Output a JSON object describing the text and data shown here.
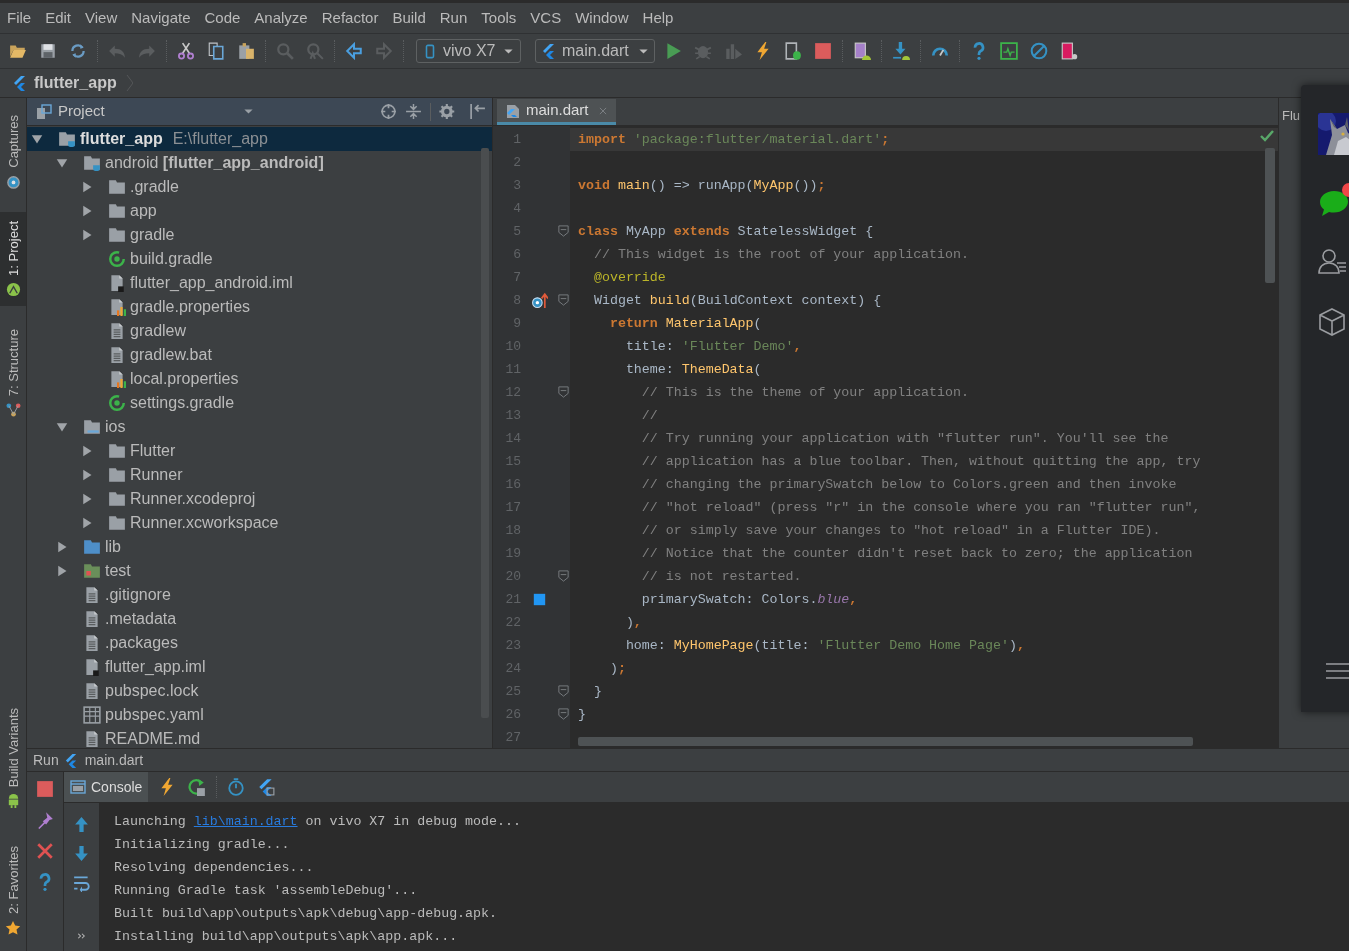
{
  "menu": [
    "File",
    "Edit",
    "View",
    "Navigate",
    "Code",
    "Analyze",
    "Refactor",
    "Build",
    "Run",
    "Tools",
    "VCS",
    "Window",
    "Help"
  ],
  "toolbar": {
    "device": "vivo X7",
    "run_config": "main.dart"
  },
  "breadcrumb": "flutter_app",
  "tool_window_bar": {
    "top": [
      {
        "label": "Captures",
        "selected": false
      },
      {
        "label": "1: Project",
        "selected": true
      },
      {
        "label": "7: Structure",
        "selected": false
      }
    ],
    "bottom": [
      {
        "label": "Build Variants",
        "selected": false
      },
      {
        "label": "2: Favorites",
        "selected": false
      }
    ]
  },
  "project": {
    "view": "Project",
    "tree": [
      {
        "label": "flutter_app",
        "path": "E:\\flutter_app",
        "kind": "module",
        "expanded": true,
        "selected": true,
        "children": [
          {
            "label": "android **[flutter_app_android]**",
            "kind": "module",
            "expanded": true,
            "selected": false,
            "children": [
              {
                "label": ".gradle",
                "kind": "folder",
                "expanded": false,
                "selected": false
              },
              {
                "label": "app",
                "kind": "folder",
                "expanded": false,
                "selected": false
              },
              {
                "label": "gradle",
                "kind": "folder",
                "expanded": false,
                "selected": false
              },
              {
                "label": "build.gradle",
                "kind": "gradle",
                "selected": false
              },
              {
                "label": "flutter_app_android.iml",
                "kind": "iml",
                "selected": false
              },
              {
                "label": "gradle.properties",
                "kind": "properties",
                "selected": false
              },
              {
                "label": "gradlew",
                "kind": "text",
                "selected": false
              },
              {
                "label": "gradlew.bat",
                "kind": "text",
                "selected": false
              },
              {
                "label": "local.properties",
                "kind": "properties",
                "selected": false
              },
              {
                "label": "settings.gradle",
                "kind": "gradle",
                "selected": false
              }
            ]
          },
          {
            "label": "ios",
            "kind": "module_folder",
            "expanded": true,
            "selected": false,
            "children": [
              {
                "label": "Flutter",
                "kind": "folder",
                "expanded": false,
                "selected": false
              },
              {
                "label": "Runner",
                "kind": "folder",
                "expanded": false,
                "selected": false
              },
              {
                "label": "Runner.xcodeproj",
                "kind": "folder",
                "expanded": false,
                "selected": false
              },
              {
                "label": "Runner.xcworkspace",
                "kind": "folder",
                "expanded": false,
                "selected": false
              }
            ]
          },
          {
            "label": "lib",
            "kind": "source",
            "expanded": false,
            "selected": false
          },
          {
            "label": "test",
            "kind": "test",
            "expanded": false,
            "selected": false
          },
          {
            "label": ".gitignore",
            "kind": "text",
            "selected": false
          },
          {
            "label": ".metadata",
            "kind": "text",
            "selected": false
          },
          {
            "label": ".packages",
            "kind": "text",
            "selected": false
          },
          {
            "label": "flutter_app.iml",
            "kind": "iml",
            "selected": false
          },
          {
            "label": "pubspec.lock",
            "kind": "text",
            "selected": false
          },
          {
            "label": "pubspec.yaml",
            "kind": "table",
            "selected": false
          },
          {
            "label": "README.md",
            "kind": "text",
            "selected": false
          }
        ]
      }
    ]
  },
  "editor": {
    "tabs": [
      {
        "label": "main.dart",
        "selected": true
      }
    ],
    "lines": [
      {
        "n": "1",
        "current": true,
        "fold": false,
        "tokens": [
          {
            "text": "import",
            "kind": "keyword"
          },
          {
            "text": " 'package:flutter/material.dart'",
            "kind": "string"
          },
          {
            "text": ";",
            "kind": "keyword"
          }
        ]
      },
      {
        "n": "2",
        "current": false,
        "fold": false
      },
      {
        "n": "3",
        "current": false,
        "fold": false,
        "tokens": [
          {
            "text": "void",
            "kind": "keyword"
          },
          {
            "text": " main",
            "kind": "call"
          },
          {
            "text": "() => runApp(",
            "kind": "plain"
          },
          {
            "text": "MyApp",
            "kind": "call"
          },
          {
            "text": "())",
            "kind": "plain"
          },
          {
            "text": ";",
            "kind": "keyword"
          }
        ]
      },
      {
        "n": "4",
        "current": false,
        "fold": false
      },
      {
        "n": "5",
        "current": false,
        "fold": true,
        "tokens": [
          {
            "text": "class",
            "kind": "keyword"
          },
          {
            "text": " MyApp ",
            "kind": "plain"
          },
          {
            "text": "extends",
            "kind": "keyword"
          },
          {
            "text": " StatelessWidget {",
            "kind": "plain"
          }
        ]
      },
      {
        "n": "6",
        "current": false,
        "fold": false,
        "tokens": [
          {
            "text": "  // This widget is the root of your application.",
            "kind": "comment"
          }
        ]
      },
      {
        "n": "7",
        "current": false,
        "fold": false,
        "tokens": [
          {
            "text": "  @override",
            "kind": "annotation"
          }
        ]
      },
      {
        "n": "8",
        "current": false,
        "fold": true,
        "gutter_mark": {
          "kind": "override"
        },
        "tokens": [
          {
            "text": "  Widget ",
            "kind": "plain"
          },
          {
            "text": "build",
            "kind": "call"
          },
          {
            "text": "(BuildContext context) {",
            "kind": "plain"
          }
        ]
      },
      {
        "n": "9",
        "current": false,
        "fold": false,
        "tokens": [
          {
            "text": "    return",
            "kind": "keyword"
          },
          {
            "text": " MaterialApp",
            "kind": "call"
          },
          {
            "text": "(",
            "kind": "plain"
          }
        ]
      },
      {
        "n": "10",
        "current": false,
        "fold": false,
        "tokens": [
          {
            "text": "      title: ",
            "kind": "plain"
          },
          {
            "text": "'Flutter Demo'",
            "kind": "string"
          },
          {
            "text": ",",
            "kind": "keyword"
          }
        ]
      },
      {
        "n": "11",
        "current": false,
        "fold": false,
        "tokens": [
          {
            "text": "      theme: ",
            "kind": "plain"
          },
          {
            "text": "ThemeData",
            "kind": "call"
          },
          {
            "text": "(",
            "kind": "plain"
          }
        ]
      },
      {
        "n": "12",
        "current": false,
        "fold": true,
        "tokens": [
          {
            "text": "        // This is the theme of your application.",
            "kind": "comment"
          }
        ]
      },
      {
        "n": "13",
        "current": false,
        "fold": false,
        "tokens": [
          {
            "text": "        //",
            "kind": "comment"
          }
        ]
      },
      {
        "n": "14",
        "current": false,
        "fold": false,
        "tokens": [
          {
            "text": "        // Try running your application with \"flutter run\". You'll see the",
            "kind": "comment"
          }
        ]
      },
      {
        "n": "15",
        "current": false,
        "fold": false,
        "tokens": [
          {
            "text": "        // application has a blue toolbar. Then, without quitting the app, try",
            "kind": "comment"
          }
        ]
      },
      {
        "n": "16",
        "current": false,
        "fold": false,
        "tokens": [
          {
            "text": "        // changing the primarySwatch below to Colors.green and then invoke",
            "kind": "comment"
          }
        ]
      },
      {
        "n": "17",
        "current": false,
        "fold": false,
        "tokens": [
          {
            "text": "        // \"hot reload\" (press \"r\" in the console where you ran \"flutter run\",",
            "kind": "comment"
          }
        ]
      },
      {
        "n": "18",
        "current": false,
        "fold": false,
        "tokens": [
          {
            "text": "        // or simply save your changes to \"hot reload\" in a Flutter IDE).",
            "kind": "comment"
          }
        ]
      },
      {
        "n": "19",
        "current": false,
        "fold": false,
        "tokens": [
          {
            "text": "        // Notice that the counter didn't reset back to zero; the application",
            "kind": "comment"
          }
        ]
      },
      {
        "n": "20",
        "current": false,
        "fold": true,
        "tokens": [
          {
            "text": "        // is not restarted.",
            "kind": "comment"
          }
        ]
      },
      {
        "n": "21",
        "current": false,
        "fold": false,
        "gutter_mark": {
          "kind": "swatch"
        },
        "tokens": [
          {
            "text": "        primarySwatch: Colors.",
            "kind": "plain"
          },
          {
            "text": "blue",
            "kind": "field"
          },
          {
            "text": ",",
            "kind": "keyword"
          }
        ]
      },
      {
        "n": "22",
        "current": false,
        "fold": false,
        "tokens": [
          {
            "text": "      )",
            "kind": "plain"
          },
          {
            "text": ",",
            "kind": "keyword"
          }
        ]
      },
      {
        "n": "23",
        "current": false,
        "fold": false,
        "tokens": [
          {
            "text": "      home: ",
            "kind": "plain"
          },
          {
            "text": "MyHomePage",
            "kind": "call"
          },
          {
            "text": "(title: ",
            "kind": "plain"
          },
          {
            "text": "'Flutter Demo Home Page'",
            "kind": "string"
          },
          {
            "text": ")",
            "kind": "plain"
          },
          {
            "text": ",",
            "kind": "keyword"
          }
        ]
      },
      {
        "n": "24",
        "current": false,
        "fold": false,
        "tokens": [
          {
            "text": "    )",
            "kind": "plain"
          },
          {
            "text": ";",
            "kind": "keyword"
          }
        ]
      },
      {
        "n": "25",
        "current": false,
        "fold": true,
        "tokens": [
          {
            "text": "  }",
            "kind": "plain"
          }
        ]
      },
      {
        "n": "26",
        "current": false,
        "fold": true,
        "tokens": [
          {
            "text": "}",
            "kind": "plain"
          }
        ]
      },
      {
        "n": "27",
        "current": false,
        "fold": false
      }
    ]
  },
  "right_panel_tab": "Flu",
  "run": {
    "title": "Run",
    "config": "main.dart",
    "tabs": [
      {
        "label": "Console",
        "selected": true
      }
    ],
    "console": [
      [
        {
          "text": "Launching ",
          "link": false
        },
        {
          "text": "lib\\main.dart",
          "link": true
        },
        {
          "text": " on vivo X7 in debug mode...",
          "link": false
        }
      ],
      [
        {
          "text": "Initializing gradle...",
          "link": false
        }
      ],
      [
        {
          "text": "Resolving dependencies...",
          "link": false
        }
      ],
      [
        {
          "text": "Running Gradle task 'assembleDebug'...",
          "link": false
        }
      ],
      [
        {
          "text": "Built build\\app\\outputs\\apk\\debug\\app-debug.apk.",
          "link": false
        }
      ],
      [
        {
          "text": "Installing build\\app\\outputs\\apk\\app.apk...",
          "link": false
        }
      ]
    ]
  }
}
